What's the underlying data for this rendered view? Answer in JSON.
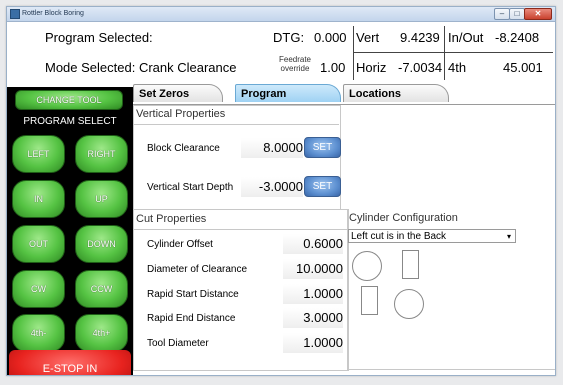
{
  "window": {
    "title": "Rottler Block Boring",
    "min_label": "–",
    "max_label": "□",
    "close_label": "✕"
  },
  "status": {
    "program_selected_label": "Program Selected:",
    "mode_selected_label": "Mode Selected: Crank Clearance",
    "dtg_label": "DTG:",
    "dtg_value": "0.000",
    "feedrate_label": "Feedrate override",
    "feedrate_value": "1.00",
    "vert_label": "Vert",
    "vert_value": "9.4239",
    "horiz_label": "Horiz",
    "horiz_value": "-7.0034",
    "inout_label": "In/Out",
    "inout_value": "-8.2408",
    "fourth_label": "4th",
    "fourth_value": "45.001"
  },
  "left_panel": {
    "change_tool": "CHANGE TOOL",
    "program_select": "PROGRAM SELECT",
    "buttons": {
      "left": "LEFT",
      "right": "RIGHT",
      "in": "IN",
      "up": "UP",
      "out": "OUT",
      "down": "DOWN",
      "cw": "CW",
      "ccw": "CCW",
      "fourth_minus": "4th-",
      "fourth_plus": "4th+"
    },
    "estop": "E-STOP IN"
  },
  "tabs": {
    "set_zeros": "Set Zeros",
    "program": "Program",
    "locations": "Locations"
  },
  "vertical": {
    "title": "Vertical Properties",
    "block_clearance_label": "Block Clearance",
    "block_clearance_value": "8.0000",
    "vertical_start_label": "Vertical Start Depth",
    "vertical_start_value": "-3.0000",
    "set_label": "SET"
  },
  "cut": {
    "title": "Cut Properties",
    "cylinder_offset_label": "Cylinder Offset",
    "cylinder_offset_value": "0.6000",
    "diameter_label": "Diameter of Clearance",
    "diameter_value": "10.0000",
    "rapid_start_label": "Rapid Start Distance",
    "rapid_start_value": "1.0000",
    "rapid_end_label": "Rapid End Distance",
    "rapid_end_value": "3.0000",
    "tool_diameter_label": "Tool Diameter",
    "tool_diameter_value": "1.0000"
  },
  "cylinder": {
    "title": "Cylinder Configuration",
    "selected": "Left cut is in the Back"
  },
  "colors": {
    "button_green": "#55c343",
    "estop_red": "#e8231f",
    "set_blue": "#5c8fd0",
    "active_tab": "#9fd2f3"
  }
}
